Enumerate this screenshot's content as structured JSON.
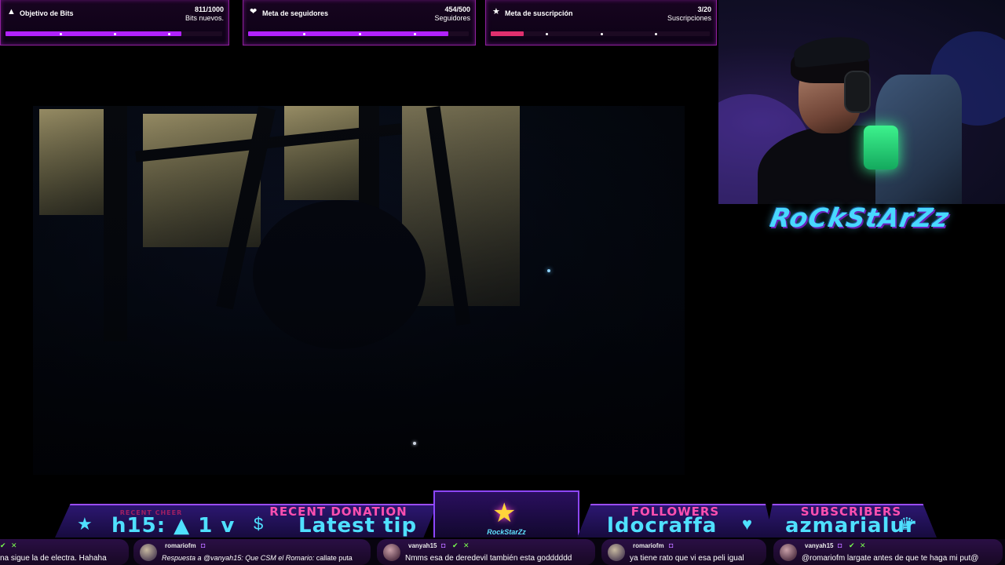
{
  "goals": [
    {
      "title": "Objetivo de Bits",
      "icon": "▲",
      "count": "811/1000",
      "sub": "Bits nuevos.",
      "progress": 0.811,
      "fill": "#b222ff"
    },
    {
      "title": "Meta de seguidores",
      "icon": "❤",
      "count": "454/500",
      "sub": "Seguidores",
      "progress": 0.908,
      "fill": "#b222ff"
    },
    {
      "title": "Meta de suscripción",
      "icon": "★",
      "count": "3/20",
      "sub": "Suscripciones",
      "progress": 0.15,
      "fill": "#e0306e"
    }
  ],
  "brand": "RoCkStArZz",
  "bottom": {
    "cheer": {
      "label": "RECENT CHEER",
      "value": "h15: ▲ 1   v",
      "icon_name": "star-icon"
    },
    "donation": {
      "label": "RECENT DONATION",
      "value": "Latest tip",
      "icon_name": "coin-icon"
    },
    "badge_text": "RockStarZz",
    "followers": {
      "label": "FOLLOWERS",
      "value": "ldocraffa",
      "icon_name": "heart-icon"
    },
    "subscribers": {
      "label": "SUBSCRIBERS",
      "value": "azmarialur",
      "icon_name": "trophy-icon"
    }
  },
  "chat": [
    {
      "user": "",
      "msg": "na sigue la de electra. Hahaha"
    },
    {
      "user": "romariofm",
      "reply": "Respuesta a @vanyah15: Que CSM el Romario:",
      "msg": "callate puta"
    },
    {
      "user": "vanyah15",
      "msg": "Nmms esa de deredevil también esta godddddd"
    },
    {
      "user": "romariofm",
      "msg": "ya tiene rato que vi esa peli igual"
    },
    {
      "user": "vanyah15",
      "msg": "@romariofm largate antes de que te haga mi put@"
    }
  ],
  "colors": {
    "accent_purple": "#9a4cff",
    "accent_pink": "#ff4fb0",
    "accent_cyan": "#4fe0ff"
  }
}
